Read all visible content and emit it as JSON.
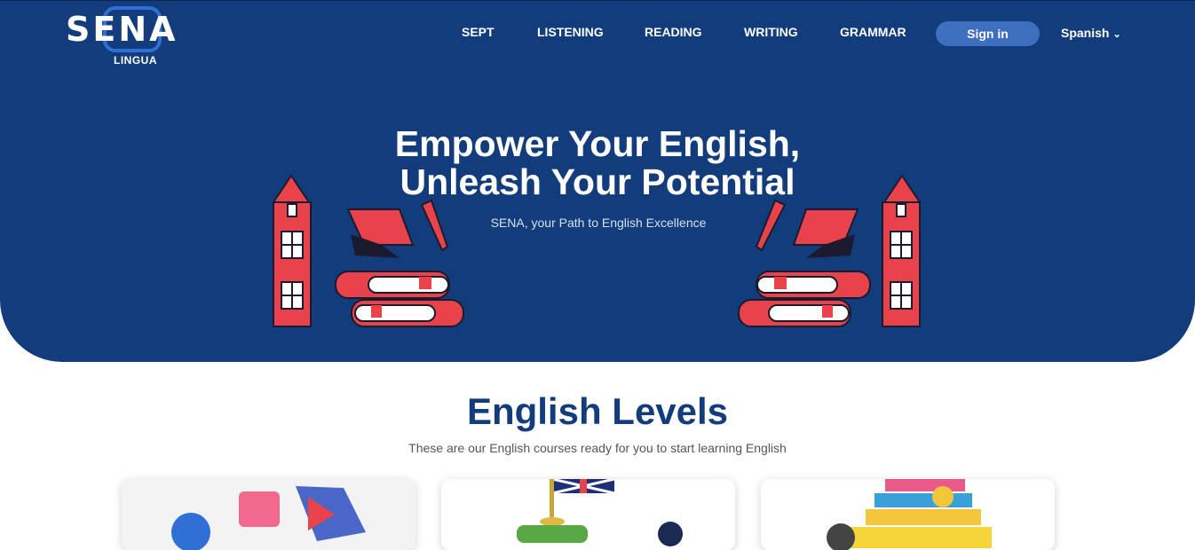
{
  "brand": {
    "logo_text": "SENA",
    "logo_sub": "LINGUA"
  },
  "nav": {
    "items": [
      "SEPT",
      "LISTENING",
      "READING",
      "WRITING",
      "GRAMMAR"
    ],
    "signin_label": "Sign in",
    "language": "Spanish"
  },
  "hero": {
    "title_line1": "Empower Your English,",
    "title_line2": "Unleash Your Potential",
    "tagline": "SENA, your Path to English Excellence"
  },
  "levels": {
    "title": "English Levels",
    "subtitle": "These are our English courses ready for you to start learning English"
  },
  "icons": [
    "chevron-down-icon"
  ],
  "colors": {
    "primary": "#133c7c",
    "accent": "#3e6fbf",
    "illustration_red": "#e8434b"
  }
}
